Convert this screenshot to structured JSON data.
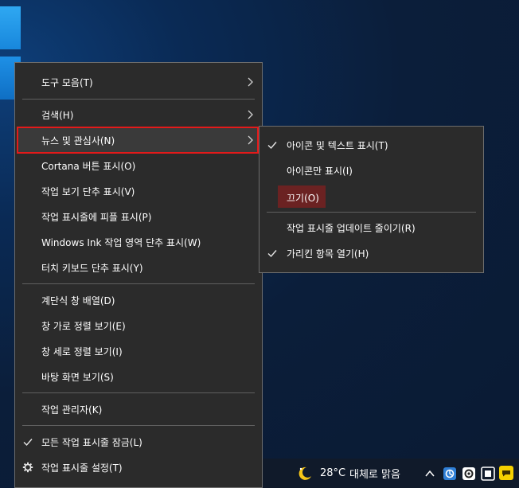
{
  "main_menu": {
    "items": [
      {
        "label": "도구 모음(T)",
        "submenu": true
      },
      {
        "label": "검색(H)",
        "submenu": true
      },
      {
        "label": "뉴스 및 관심사(N)",
        "submenu": true
      },
      {
        "label": "Cortana 버튼 표시(O)"
      },
      {
        "label": "작업 보기 단추 표시(V)"
      },
      {
        "label": "작업 표시줄에 피플 표시(P)"
      },
      {
        "label": "Windows Ink 작업 영역 단추 표시(W)"
      },
      {
        "label": "터치 키보드 단추 표시(Y)"
      },
      {
        "label": "계단식 창 배열(D)"
      },
      {
        "label": "창 가로 정렬 보기(E)"
      },
      {
        "label": "창 세로 정렬 보기(I)"
      },
      {
        "label": "바탕 화면 보기(S)"
      },
      {
        "label": "작업 관리자(K)"
      },
      {
        "label": "모든 작업 표시줄 잠금(L)",
        "checked": true
      },
      {
        "label": "작업 표시줄 설정(T)",
        "icon": "gear-icon"
      }
    ]
  },
  "sub_menu": {
    "items": [
      {
        "label": "아이콘 및 텍스트 표시(T)",
        "checked": true
      },
      {
        "label": "아이콘만 표시(I)"
      },
      {
        "label": "끄기(O)",
        "highlighted": true
      },
      {
        "label": "작업 표시줄 업데이트 줄이기(R)"
      },
      {
        "label": "가리킨 항목 열기(H)",
        "checked": true
      }
    ]
  },
  "taskbar": {
    "temperature": "28°C",
    "condition": "대체로 맑음",
    "tray_icons": [
      "chevron-up-icon",
      "network-icon",
      "record-icon",
      "gallery-icon",
      "dice-icon",
      "chat-icon"
    ]
  },
  "colors": {
    "menu_bg": "#2b2b2b",
    "highlight_border": "#e31a1a",
    "off_item_bg": "#6b2222",
    "desktop_bg": "#0b1e3a"
  }
}
